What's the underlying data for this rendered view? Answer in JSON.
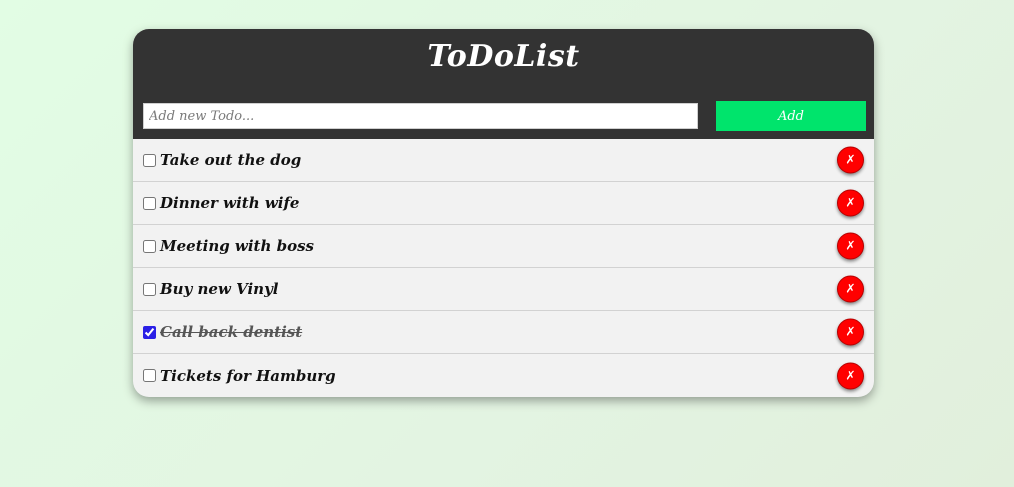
{
  "app": {
    "title": "ToDoList",
    "input_placeholder": "Add new Todo...",
    "add_label": "Add",
    "delete_glyph": "✗"
  },
  "colors": {
    "header": "#333333",
    "add_button": "#00e46c",
    "delete_button": "#ff0000",
    "list_background": "#f2f2f2"
  },
  "todos": [
    {
      "text": "Take out the dog",
      "done": false
    },
    {
      "text": "Dinner with wife",
      "done": false
    },
    {
      "text": "Meeting with boss",
      "done": false
    },
    {
      "text": "Buy new Vinyl",
      "done": false
    },
    {
      "text": "Call back dentist",
      "done": true
    },
    {
      "text": "Tickets for Hamburg",
      "done": false
    }
  ]
}
